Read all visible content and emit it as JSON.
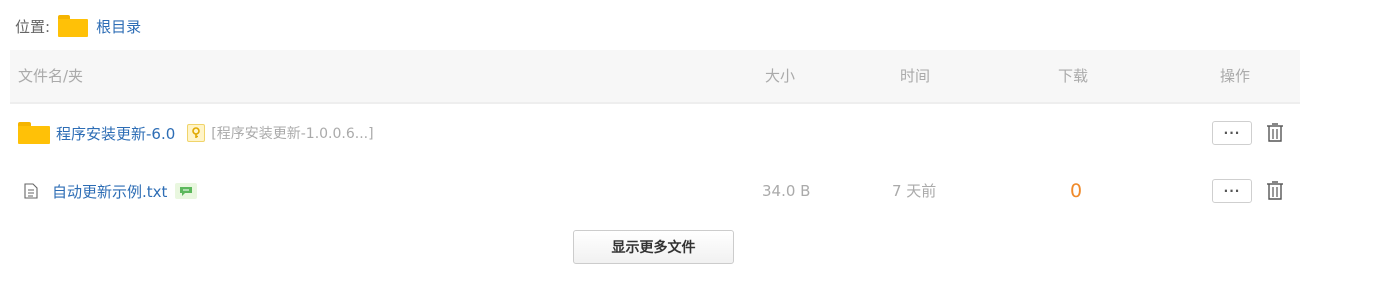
{
  "breadcrumb": {
    "label": "位置:",
    "root": "根目录"
  },
  "table": {
    "headers": {
      "name": "文件名/夹",
      "size": "大小",
      "time": "时间",
      "downloads": "下载",
      "actions": "操作"
    },
    "rows": [
      {
        "type": "folder",
        "name": "程序安装更新-6.0",
        "note": "[程序安装更新-1.0.0.6...]",
        "size": "",
        "time": "",
        "downloads": ""
      },
      {
        "type": "file",
        "name": "自动更新示例.txt",
        "size": "34.0 B",
        "time": "7 天前",
        "downloads": "0"
      }
    ],
    "more_label": "···"
  },
  "footer": {
    "show_more_label": "显示更多文件"
  },
  "colors": {
    "link": "#2d6db5",
    "folder": "#ffc107",
    "download_count": "#f08a2a"
  }
}
